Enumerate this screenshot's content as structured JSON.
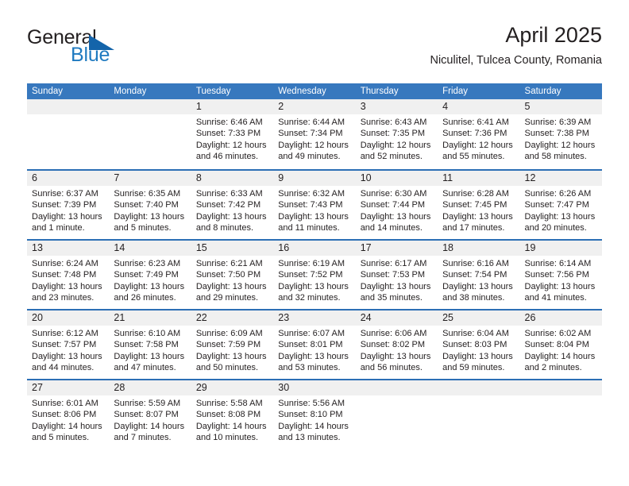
{
  "brand": {
    "word_one": "General",
    "word_two": "Blue",
    "triangle_color": "#1464aa",
    "blue_color": "#1f7ac0"
  },
  "header": {
    "title": "April 2025",
    "subtitle": "Niculitel, Tulcea County, Romania"
  },
  "theme": {
    "header_blue": "#3778be",
    "row_divider_blue": "#2c6fb5",
    "daynum_band": "#f0f0f0",
    "text": "#231f20"
  },
  "weekdays": [
    "Sunday",
    "Monday",
    "Tuesday",
    "Wednesday",
    "Thursday",
    "Friday",
    "Saturday"
  ],
  "weeks": [
    [
      {
        "day": "",
        "sunrise": "",
        "sunset": "",
        "daylight_a": "",
        "daylight_b": ""
      },
      {
        "day": "",
        "sunrise": "",
        "sunset": "",
        "daylight_a": "",
        "daylight_b": ""
      },
      {
        "day": "1",
        "sunrise": "Sunrise: 6:46 AM",
        "sunset": "Sunset: 7:33 PM",
        "daylight_a": "Daylight: 12 hours",
        "daylight_b": "and 46 minutes."
      },
      {
        "day": "2",
        "sunrise": "Sunrise: 6:44 AM",
        "sunset": "Sunset: 7:34 PM",
        "daylight_a": "Daylight: 12 hours",
        "daylight_b": "and 49 minutes."
      },
      {
        "day": "3",
        "sunrise": "Sunrise: 6:43 AM",
        "sunset": "Sunset: 7:35 PM",
        "daylight_a": "Daylight: 12 hours",
        "daylight_b": "and 52 minutes."
      },
      {
        "day": "4",
        "sunrise": "Sunrise: 6:41 AM",
        "sunset": "Sunset: 7:36 PM",
        "daylight_a": "Daylight: 12 hours",
        "daylight_b": "and 55 minutes."
      },
      {
        "day": "5",
        "sunrise": "Sunrise: 6:39 AM",
        "sunset": "Sunset: 7:38 PM",
        "daylight_a": "Daylight: 12 hours",
        "daylight_b": "and 58 minutes."
      }
    ],
    [
      {
        "day": "6",
        "sunrise": "Sunrise: 6:37 AM",
        "sunset": "Sunset: 7:39 PM",
        "daylight_a": "Daylight: 13 hours",
        "daylight_b": "and 1 minute."
      },
      {
        "day": "7",
        "sunrise": "Sunrise: 6:35 AM",
        "sunset": "Sunset: 7:40 PM",
        "daylight_a": "Daylight: 13 hours",
        "daylight_b": "and 5 minutes."
      },
      {
        "day": "8",
        "sunrise": "Sunrise: 6:33 AM",
        "sunset": "Sunset: 7:42 PM",
        "daylight_a": "Daylight: 13 hours",
        "daylight_b": "and 8 minutes."
      },
      {
        "day": "9",
        "sunrise": "Sunrise: 6:32 AM",
        "sunset": "Sunset: 7:43 PM",
        "daylight_a": "Daylight: 13 hours",
        "daylight_b": "and 11 minutes."
      },
      {
        "day": "10",
        "sunrise": "Sunrise: 6:30 AM",
        "sunset": "Sunset: 7:44 PM",
        "daylight_a": "Daylight: 13 hours",
        "daylight_b": "and 14 minutes."
      },
      {
        "day": "11",
        "sunrise": "Sunrise: 6:28 AM",
        "sunset": "Sunset: 7:45 PM",
        "daylight_a": "Daylight: 13 hours",
        "daylight_b": "and 17 minutes."
      },
      {
        "day": "12",
        "sunrise": "Sunrise: 6:26 AM",
        "sunset": "Sunset: 7:47 PM",
        "daylight_a": "Daylight: 13 hours",
        "daylight_b": "and 20 minutes."
      }
    ],
    [
      {
        "day": "13",
        "sunrise": "Sunrise: 6:24 AM",
        "sunset": "Sunset: 7:48 PM",
        "daylight_a": "Daylight: 13 hours",
        "daylight_b": "and 23 minutes."
      },
      {
        "day": "14",
        "sunrise": "Sunrise: 6:23 AM",
        "sunset": "Sunset: 7:49 PM",
        "daylight_a": "Daylight: 13 hours",
        "daylight_b": "and 26 minutes."
      },
      {
        "day": "15",
        "sunrise": "Sunrise: 6:21 AM",
        "sunset": "Sunset: 7:50 PM",
        "daylight_a": "Daylight: 13 hours",
        "daylight_b": "and 29 minutes."
      },
      {
        "day": "16",
        "sunrise": "Sunrise: 6:19 AM",
        "sunset": "Sunset: 7:52 PM",
        "daylight_a": "Daylight: 13 hours",
        "daylight_b": "and 32 minutes."
      },
      {
        "day": "17",
        "sunrise": "Sunrise: 6:17 AM",
        "sunset": "Sunset: 7:53 PM",
        "daylight_a": "Daylight: 13 hours",
        "daylight_b": "and 35 minutes."
      },
      {
        "day": "18",
        "sunrise": "Sunrise: 6:16 AM",
        "sunset": "Sunset: 7:54 PM",
        "daylight_a": "Daylight: 13 hours",
        "daylight_b": "and 38 minutes."
      },
      {
        "day": "19",
        "sunrise": "Sunrise: 6:14 AM",
        "sunset": "Sunset: 7:56 PM",
        "daylight_a": "Daylight: 13 hours",
        "daylight_b": "and 41 minutes."
      }
    ],
    [
      {
        "day": "20",
        "sunrise": "Sunrise: 6:12 AM",
        "sunset": "Sunset: 7:57 PM",
        "daylight_a": "Daylight: 13 hours",
        "daylight_b": "and 44 minutes."
      },
      {
        "day": "21",
        "sunrise": "Sunrise: 6:10 AM",
        "sunset": "Sunset: 7:58 PM",
        "daylight_a": "Daylight: 13 hours",
        "daylight_b": "and 47 minutes."
      },
      {
        "day": "22",
        "sunrise": "Sunrise: 6:09 AM",
        "sunset": "Sunset: 7:59 PM",
        "daylight_a": "Daylight: 13 hours",
        "daylight_b": "and 50 minutes."
      },
      {
        "day": "23",
        "sunrise": "Sunrise: 6:07 AM",
        "sunset": "Sunset: 8:01 PM",
        "daylight_a": "Daylight: 13 hours",
        "daylight_b": "and 53 minutes."
      },
      {
        "day": "24",
        "sunrise": "Sunrise: 6:06 AM",
        "sunset": "Sunset: 8:02 PM",
        "daylight_a": "Daylight: 13 hours",
        "daylight_b": "and 56 minutes."
      },
      {
        "day": "25",
        "sunrise": "Sunrise: 6:04 AM",
        "sunset": "Sunset: 8:03 PM",
        "daylight_a": "Daylight: 13 hours",
        "daylight_b": "and 59 minutes."
      },
      {
        "day": "26",
        "sunrise": "Sunrise: 6:02 AM",
        "sunset": "Sunset: 8:04 PM",
        "daylight_a": "Daylight: 14 hours",
        "daylight_b": "and 2 minutes."
      }
    ],
    [
      {
        "day": "27",
        "sunrise": "Sunrise: 6:01 AM",
        "sunset": "Sunset: 8:06 PM",
        "daylight_a": "Daylight: 14 hours",
        "daylight_b": "and 5 minutes."
      },
      {
        "day": "28",
        "sunrise": "Sunrise: 5:59 AM",
        "sunset": "Sunset: 8:07 PM",
        "daylight_a": "Daylight: 14 hours",
        "daylight_b": "and 7 minutes."
      },
      {
        "day": "29",
        "sunrise": "Sunrise: 5:58 AM",
        "sunset": "Sunset: 8:08 PM",
        "daylight_a": "Daylight: 14 hours",
        "daylight_b": "and 10 minutes."
      },
      {
        "day": "30",
        "sunrise": "Sunrise: 5:56 AM",
        "sunset": "Sunset: 8:10 PM",
        "daylight_a": "Daylight: 14 hours",
        "daylight_b": "and 13 minutes."
      },
      {
        "day": "",
        "sunrise": "",
        "sunset": "",
        "daylight_a": "",
        "daylight_b": ""
      },
      {
        "day": "",
        "sunrise": "",
        "sunset": "",
        "daylight_a": "",
        "daylight_b": ""
      },
      {
        "day": "",
        "sunrise": "",
        "sunset": "",
        "daylight_a": "",
        "daylight_b": ""
      }
    ]
  ]
}
